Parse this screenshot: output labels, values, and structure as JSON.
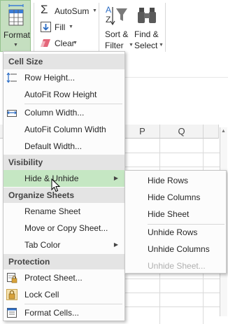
{
  "ribbon": {
    "format_label": "Format",
    "autosum_label": "AutoSum",
    "fill_label": "Fill",
    "clear_label": "Clear",
    "sort_label_1": "Sort &",
    "sort_label_2": "Filter",
    "find_label_1": "Find &",
    "find_label_2": "Select"
  },
  "columns": [
    "P",
    "Q"
  ],
  "menu": {
    "sections": [
      {
        "title": "Cell Size"
      },
      {
        "title": "Visibility"
      },
      {
        "title": "Organize Sheets"
      },
      {
        "title": "Protection"
      }
    ],
    "items": [
      {
        "label": "Row Height...",
        "icon": "row-height-icon"
      },
      {
        "label": "AutoFit Row Height"
      },
      {
        "label": "Column Width...",
        "icon": "column-width-icon"
      },
      {
        "label": "AutoFit Column Width"
      },
      {
        "label": "Default Width..."
      },
      {
        "label": "Hide & Unhide",
        "highlighted": true,
        "has_submenu": true
      },
      {
        "label": "Rename Sheet"
      },
      {
        "label": "Move or Copy Sheet..."
      },
      {
        "label": "Tab Color",
        "has_submenu": true
      },
      {
        "label": "Protect Sheet...",
        "icon": "protect-sheet-icon"
      },
      {
        "label": "Lock Cell",
        "icon": "lock-icon"
      },
      {
        "label": "Format Cells...",
        "icon": "format-cells-icon"
      }
    ]
  },
  "submenu": {
    "items": [
      {
        "label": "Hide Rows"
      },
      {
        "label": "Hide Columns"
      },
      {
        "label": "Hide Sheet"
      },
      {
        "label": "Unhide Rows"
      },
      {
        "label": "Unhide Columns"
      },
      {
        "label": "Unhide Sheet...",
        "disabled": true
      }
    ]
  },
  "colors": {
    "highlight": "#c5e7c3",
    "format_button": "#c5dfc0",
    "section_header": "#e4e4e4",
    "disabled_text": "#b0b0b0"
  }
}
